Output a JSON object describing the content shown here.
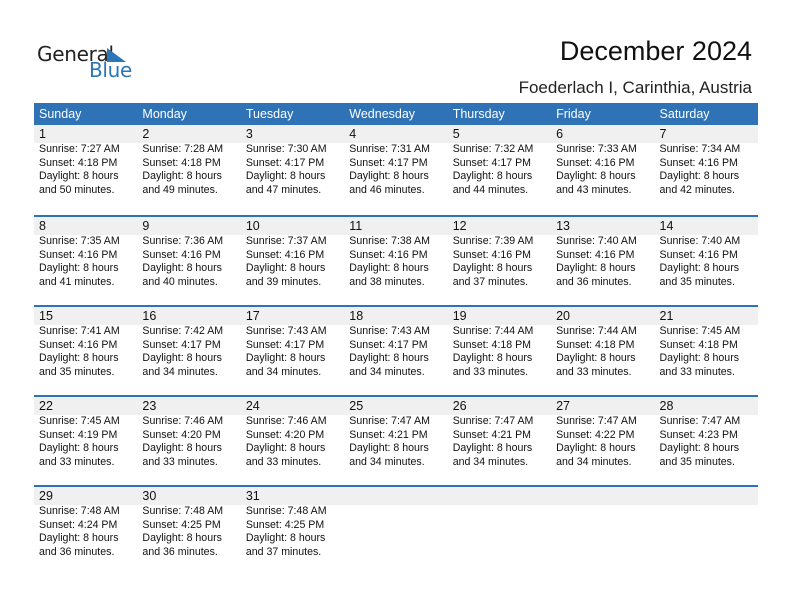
{
  "brand": {
    "general": "General",
    "blue": "Blue"
  },
  "header": {
    "title": "December 2024",
    "location": "Foederlach I, Carinthia, Austria"
  },
  "colors": {
    "accent": "#2f72b5",
    "band": "#f0f0f0"
  },
  "weekdays": [
    "Sunday",
    "Monday",
    "Tuesday",
    "Wednesday",
    "Thursday",
    "Friday",
    "Saturday"
  ],
  "weeks": [
    [
      {
        "day": "1",
        "sunrise": "Sunrise: 7:27 AM",
        "sunset": "Sunset: 4:18 PM",
        "daylight1": "Daylight: 8 hours",
        "daylight2": "and 50 minutes."
      },
      {
        "day": "2",
        "sunrise": "Sunrise: 7:28 AM",
        "sunset": "Sunset: 4:18 PM",
        "daylight1": "Daylight: 8 hours",
        "daylight2": "and 49 minutes."
      },
      {
        "day": "3",
        "sunrise": "Sunrise: 7:30 AM",
        "sunset": "Sunset: 4:17 PM",
        "daylight1": "Daylight: 8 hours",
        "daylight2": "and 47 minutes."
      },
      {
        "day": "4",
        "sunrise": "Sunrise: 7:31 AM",
        "sunset": "Sunset: 4:17 PM",
        "daylight1": "Daylight: 8 hours",
        "daylight2": "and 46 minutes."
      },
      {
        "day": "5",
        "sunrise": "Sunrise: 7:32 AM",
        "sunset": "Sunset: 4:17 PM",
        "daylight1": "Daylight: 8 hours",
        "daylight2": "and 44 minutes."
      },
      {
        "day": "6",
        "sunrise": "Sunrise: 7:33 AM",
        "sunset": "Sunset: 4:16 PM",
        "daylight1": "Daylight: 8 hours",
        "daylight2": "and 43 minutes."
      },
      {
        "day": "7",
        "sunrise": "Sunrise: 7:34 AM",
        "sunset": "Sunset: 4:16 PM",
        "daylight1": "Daylight: 8 hours",
        "daylight2": "and 42 minutes."
      }
    ],
    [
      {
        "day": "8",
        "sunrise": "Sunrise: 7:35 AM",
        "sunset": "Sunset: 4:16 PM",
        "daylight1": "Daylight: 8 hours",
        "daylight2": "and 41 minutes."
      },
      {
        "day": "9",
        "sunrise": "Sunrise: 7:36 AM",
        "sunset": "Sunset: 4:16 PM",
        "daylight1": "Daylight: 8 hours",
        "daylight2": "and 40 minutes."
      },
      {
        "day": "10",
        "sunrise": "Sunrise: 7:37 AM",
        "sunset": "Sunset: 4:16 PM",
        "daylight1": "Daylight: 8 hours",
        "daylight2": "and 39 minutes."
      },
      {
        "day": "11",
        "sunrise": "Sunrise: 7:38 AM",
        "sunset": "Sunset: 4:16 PM",
        "daylight1": "Daylight: 8 hours",
        "daylight2": "and 38 minutes."
      },
      {
        "day": "12",
        "sunrise": "Sunrise: 7:39 AM",
        "sunset": "Sunset: 4:16 PM",
        "daylight1": "Daylight: 8 hours",
        "daylight2": "and 37 minutes."
      },
      {
        "day": "13",
        "sunrise": "Sunrise: 7:40 AM",
        "sunset": "Sunset: 4:16 PM",
        "daylight1": "Daylight: 8 hours",
        "daylight2": "and 36 minutes."
      },
      {
        "day": "14",
        "sunrise": "Sunrise: 7:40 AM",
        "sunset": "Sunset: 4:16 PM",
        "daylight1": "Daylight: 8 hours",
        "daylight2": "and 35 minutes."
      }
    ],
    [
      {
        "day": "15",
        "sunrise": "Sunrise: 7:41 AM",
        "sunset": "Sunset: 4:16 PM",
        "daylight1": "Daylight: 8 hours",
        "daylight2": "and 35 minutes."
      },
      {
        "day": "16",
        "sunrise": "Sunrise: 7:42 AM",
        "sunset": "Sunset: 4:17 PM",
        "daylight1": "Daylight: 8 hours",
        "daylight2": "and 34 minutes."
      },
      {
        "day": "17",
        "sunrise": "Sunrise: 7:43 AM",
        "sunset": "Sunset: 4:17 PM",
        "daylight1": "Daylight: 8 hours",
        "daylight2": "and 34 minutes."
      },
      {
        "day": "18",
        "sunrise": "Sunrise: 7:43 AM",
        "sunset": "Sunset: 4:17 PM",
        "daylight1": "Daylight: 8 hours",
        "daylight2": "and 34 minutes."
      },
      {
        "day": "19",
        "sunrise": "Sunrise: 7:44 AM",
        "sunset": "Sunset: 4:18 PM",
        "daylight1": "Daylight: 8 hours",
        "daylight2": "and 33 minutes."
      },
      {
        "day": "20",
        "sunrise": "Sunrise: 7:44 AM",
        "sunset": "Sunset: 4:18 PM",
        "daylight1": "Daylight: 8 hours",
        "daylight2": "and 33 minutes."
      },
      {
        "day": "21",
        "sunrise": "Sunrise: 7:45 AM",
        "sunset": "Sunset: 4:18 PM",
        "daylight1": "Daylight: 8 hours",
        "daylight2": "and 33 minutes."
      }
    ],
    [
      {
        "day": "22",
        "sunrise": "Sunrise: 7:45 AM",
        "sunset": "Sunset: 4:19 PM",
        "daylight1": "Daylight: 8 hours",
        "daylight2": "and 33 minutes."
      },
      {
        "day": "23",
        "sunrise": "Sunrise: 7:46 AM",
        "sunset": "Sunset: 4:20 PM",
        "daylight1": "Daylight: 8 hours",
        "daylight2": "and 33 minutes."
      },
      {
        "day": "24",
        "sunrise": "Sunrise: 7:46 AM",
        "sunset": "Sunset: 4:20 PM",
        "daylight1": "Daylight: 8 hours",
        "daylight2": "and 33 minutes."
      },
      {
        "day": "25",
        "sunrise": "Sunrise: 7:47 AM",
        "sunset": "Sunset: 4:21 PM",
        "daylight1": "Daylight: 8 hours",
        "daylight2": "and 34 minutes."
      },
      {
        "day": "26",
        "sunrise": "Sunrise: 7:47 AM",
        "sunset": "Sunset: 4:21 PM",
        "daylight1": "Daylight: 8 hours",
        "daylight2": "and 34 minutes."
      },
      {
        "day": "27",
        "sunrise": "Sunrise: 7:47 AM",
        "sunset": "Sunset: 4:22 PM",
        "daylight1": "Daylight: 8 hours",
        "daylight2": "and 34 minutes."
      },
      {
        "day": "28",
        "sunrise": "Sunrise: 7:47 AM",
        "sunset": "Sunset: 4:23 PM",
        "daylight1": "Daylight: 8 hours",
        "daylight2": "and 35 minutes."
      }
    ],
    [
      {
        "day": "29",
        "sunrise": "Sunrise: 7:48 AM",
        "sunset": "Sunset: 4:24 PM",
        "daylight1": "Daylight: 8 hours",
        "daylight2": "and 36 minutes."
      },
      {
        "day": "30",
        "sunrise": "Sunrise: 7:48 AM",
        "sunset": "Sunset: 4:25 PM",
        "daylight1": "Daylight: 8 hours",
        "daylight2": "and 36 minutes."
      },
      {
        "day": "31",
        "sunrise": "Sunrise: 7:48 AM",
        "sunset": "Sunset: 4:25 PM",
        "daylight1": "Daylight: 8 hours",
        "daylight2": "and 37 minutes."
      },
      null,
      null,
      null,
      null
    ]
  ]
}
